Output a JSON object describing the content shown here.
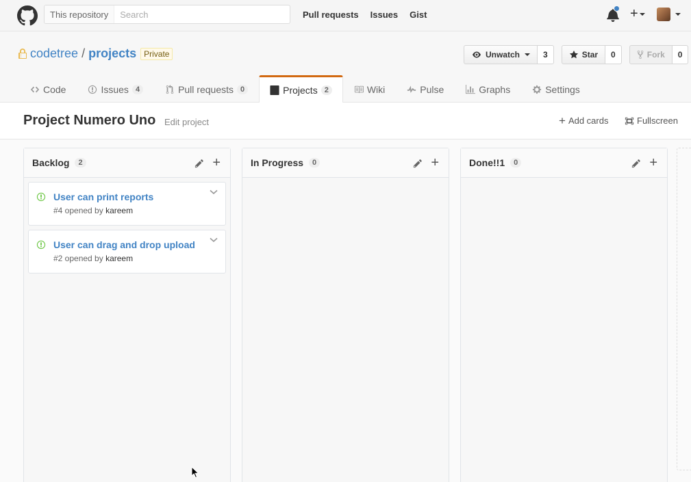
{
  "header": {
    "scope_label": "This repository",
    "search_placeholder": "Search",
    "nav": [
      "Pull requests",
      "Issues",
      "Gist"
    ]
  },
  "repo": {
    "owner": "codetree",
    "separator": "/",
    "name": "projects",
    "visibility": "Private",
    "watch": {
      "label": "Unwatch",
      "count": "3"
    },
    "star": {
      "label": "Star",
      "count": "0"
    },
    "fork": {
      "label": "Fork",
      "count": "0"
    }
  },
  "tabs": [
    {
      "label": "Code",
      "icon": "code-icon",
      "counter": ""
    },
    {
      "label": "Issues",
      "icon": "issue-icon",
      "counter": "4"
    },
    {
      "label": "Pull requests",
      "icon": "pull-request-icon",
      "counter": "0"
    },
    {
      "label": "Projects",
      "icon": "project-icon",
      "counter": "2",
      "selected": true
    },
    {
      "label": "Wiki",
      "icon": "book-icon",
      "counter": ""
    },
    {
      "label": "Pulse",
      "icon": "pulse-icon",
      "counter": ""
    },
    {
      "label": "Graphs",
      "icon": "graph-icon",
      "counter": ""
    },
    {
      "label": "Settings",
      "icon": "gear-icon",
      "counter": ""
    }
  ],
  "project": {
    "title": "Project Numero Uno",
    "edit_label": "Edit project",
    "add_cards_label": "Add cards",
    "fullscreen_label": "Fullscreen"
  },
  "columns": [
    {
      "name": "Backlog",
      "count": "2",
      "cards": [
        {
          "title": "User can print reports",
          "meta_prefix": "#4 opened by",
          "author": "kareem"
        },
        {
          "title": "User can drag and drop upload",
          "meta_prefix": "#2 opened by",
          "author": "kareem"
        }
      ]
    },
    {
      "name": "In Progress",
      "count": "0",
      "cards": []
    },
    {
      "name": "Done!!1",
      "count": "0",
      "cards": []
    }
  ],
  "colors": {
    "link": "#4183c4",
    "tab_accent": "#d26911",
    "open_issue": "#6cc644",
    "notification": "#4183c4"
  }
}
